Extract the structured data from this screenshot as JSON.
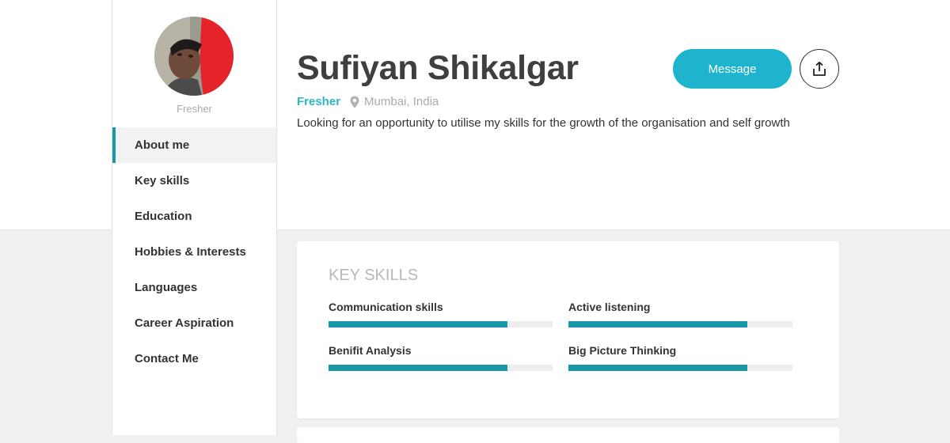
{
  "profile": {
    "name": "Sufiyan Shikalgar",
    "avatar_caption": "Fresher",
    "status": "Fresher",
    "location_icon": "map-pin-icon",
    "location": "Mumbai, India",
    "summary": "Looking for an opportunity to utilise my skills for the growth of the organisation and self growth"
  },
  "actions": {
    "message_label": "Message",
    "share_icon": "share-upload-icon"
  },
  "sidebar": {
    "items": [
      {
        "label": "About me",
        "active": true
      },
      {
        "label": "Key skills",
        "active": false
      },
      {
        "label": "Education",
        "active": false
      },
      {
        "label": "Hobbies & Interests",
        "active": false
      },
      {
        "label": "Languages",
        "active": false
      },
      {
        "label": "Career Aspiration",
        "active": false
      },
      {
        "label": "Contact Me",
        "active": false
      }
    ]
  },
  "key_skills": {
    "title": "KEY SKILLS",
    "skills": [
      {
        "name": "Communication skills",
        "level": 0.8
      },
      {
        "name": "Active listening",
        "level": 0.8
      },
      {
        "name": "Benifit Analysis",
        "level": 0.8
      },
      {
        "name": "Big Picture Thinking",
        "level": 0.8
      }
    ]
  },
  "colors": {
    "accent": "#1b98a8",
    "button": "#1eb4cd",
    "status_text": "#2bb7c9"
  }
}
